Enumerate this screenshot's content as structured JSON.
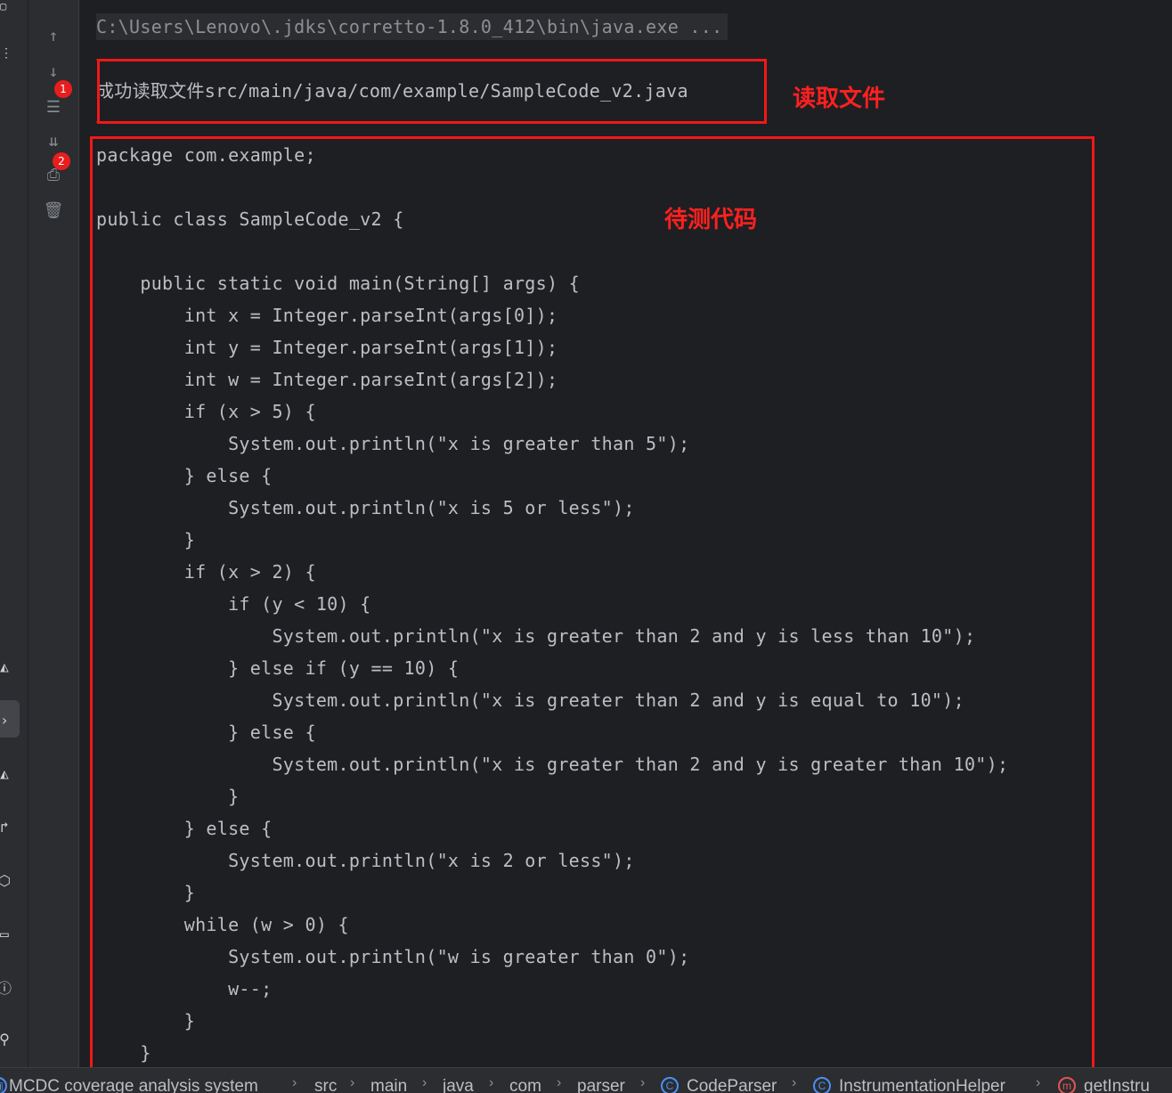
{
  "console": {
    "command": "C:\\Users\\Lenovo\\.jdks\\corretto-1.8.0_412\\bin\\java.exe ...",
    "message": "成功读取文件src/main/java/com/example/SampleCode_v2.java",
    "code_lines": [
      "package com.example;",
      "",
      "public class SampleCode_v2 {",
      "",
      "    public static void main(String[] args) {",
      "        int x = Integer.parseInt(args[0]);",
      "        int y = Integer.parseInt(args[1]);",
      "        int w = Integer.parseInt(args[2]);",
      "        if (x > 5) {",
      "            System.out.println(\"x is greater than 5\");",
      "        } else {",
      "            System.out.println(\"x is 5 or less\");",
      "        }",
      "        if (x > 2) {",
      "            if (y < 10) {",
      "                System.out.println(\"x is greater than 2 and y is less than 10\");",
      "            } else if (y == 10) {",
      "                System.out.println(\"x is greater than 2 and y is equal to 10\");",
      "            } else {",
      "                System.out.println(\"x is greater than 2 and y is greater than 10\");",
      "            }",
      "        } else {",
      "            System.out.println(\"x is 2 or less\");",
      "        }",
      "        while (w > 0) {",
      "            System.out.println(\"w is greater than 0\");",
      "            w--;",
      "        }",
      "    }"
    ]
  },
  "annotations": {
    "read_file": "读取文件",
    "code_under_test": "待测代码",
    "badge_1": "1",
    "badge_2": "2"
  },
  "toolbar": {
    "icons": [
      "arrow-up-icon",
      "arrow-down-icon",
      "soft-wrap-icon",
      "scroll-to-end-icon",
      "print-icon",
      "trash-icon"
    ]
  },
  "breadcrumb": {
    "items": [
      "MCDC coverage analysis system",
      "src",
      "main",
      "java",
      "com",
      "parser",
      "CodeParser",
      "InstrumentationHelper",
      "getInstru"
    ]
  },
  "colors": {
    "background": "#1e1f22",
    "panel": "#2b2d30",
    "text": "#bcbec4",
    "annotation_red": "#f01818",
    "link_blue": "#4c8ff3"
  }
}
